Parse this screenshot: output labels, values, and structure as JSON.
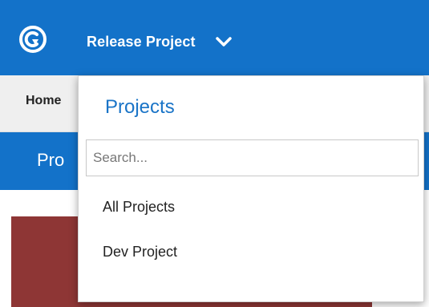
{
  "header": {
    "logo_icon": "app-logo-icon",
    "current_project": "Release Project",
    "switcher_icon": "chevron-down-icon",
    "accent_color": "#1372c9"
  },
  "breadcrumb": {
    "home_label": "Home"
  },
  "page": {
    "title": "Pro"
  },
  "project_dropdown": {
    "title": "Projects",
    "search_placeholder": "Search...",
    "search_value": "",
    "items": [
      {
        "label": "All Projects"
      },
      {
        "label": "Dev Project"
      }
    ]
  }
}
